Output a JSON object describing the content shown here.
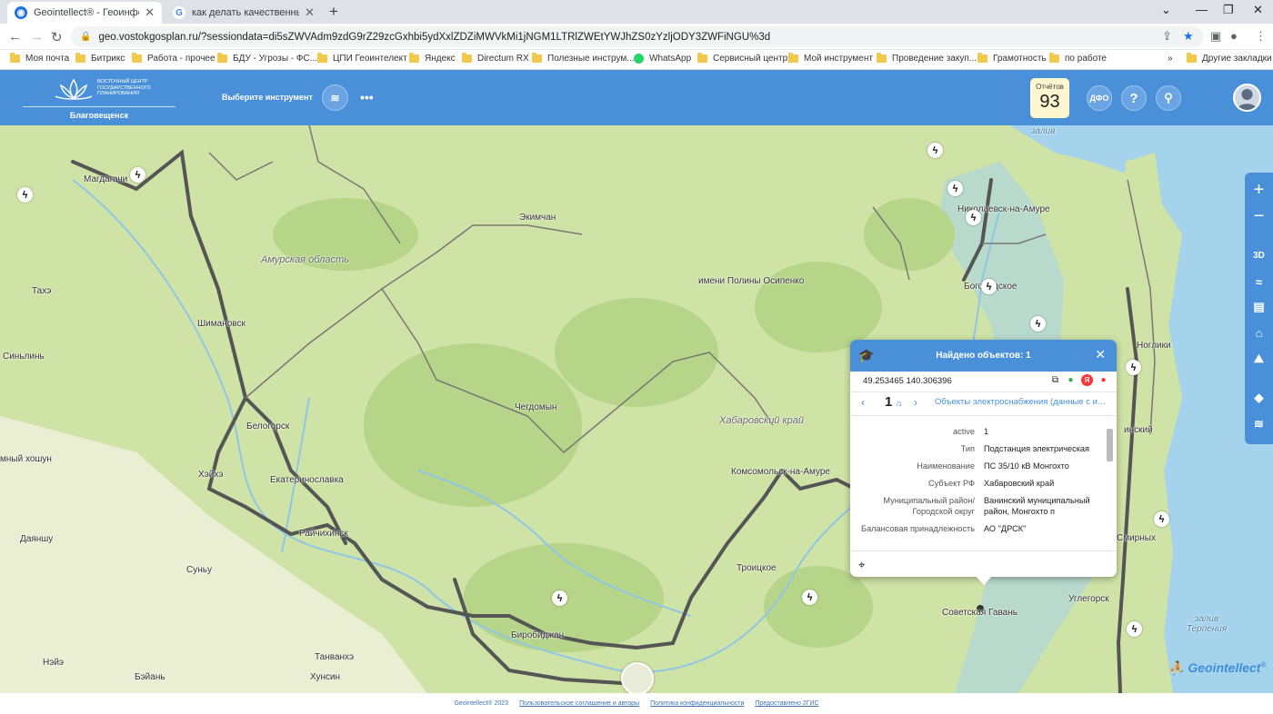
{
  "browser": {
    "tabs": [
      {
        "title": "Geointellect® - Геоинформаци",
        "active": true
      },
      {
        "title": "как делать качественные снимк",
        "active": false
      }
    ],
    "url": "geo.vostokgosplan.ru/?sessiondata=di5sZWVAdm9zdG9rZ29zcGxhbi5ydXxlZDZiMWVkMi1jNGM1LTRlZWEtYWJhZS0zYzljODY3ZWFiNGU%3d",
    "bookmarks": [
      "Моя почта",
      "Битрикс",
      "Работа - прочее",
      "БДУ - Угрозы - ФС...",
      "ЦПИ Геоинтелект",
      "Яндекс",
      "Directum RX",
      "Полезные инструм...",
      "WhatsApp",
      "Сервисный центр",
      "Мой инструмент",
      "Проведение закуп...",
      "Грамотность",
      "по работе"
    ],
    "other_bookmarks": "Другие закладки",
    "more_bookmarks": "»"
  },
  "header": {
    "org_name": "ВОСТОЧНЫЙ ЦЕНТР ГОСУДАРСТВЕННОГО ПЛАНИРОВАНИЯ",
    "city": "Благовещенск",
    "tool_select": "Выберите инструмент",
    "reports_label": "Отчётов",
    "reports_count": "93",
    "dfo": "ДФО",
    "help": "?"
  },
  "map_labels": {
    "zaliv_top": "залив",
    "magdagachi": "Магдагачи",
    "ekimchan": "Экимчан",
    "amur_region": "Амурская область",
    "takhe": "Тахэ",
    "sinlin": "Синьлинь",
    "shimanovsk": "Шимановск",
    "belogorsk": "Белогорск",
    "mny_khoshun": "мный хошун",
    "kheihe": "Хэйхэ",
    "ekaterinoslavka": "Екатеринославка",
    "raichikhinsk": "Райчихинск",
    "dayanshu": "Даяншу",
    "sunu": "Суньу",
    "tanvanhe": "Танванхэ",
    "neie": "Нэйэ",
    "beian": "Бэйань",
    "khunsin": "Хунсин",
    "birobidzhan": "Биробиджан",
    "chegdomyn": "Чегдомын",
    "polina_osipenko": "имени Полины Осипенко",
    "khabarovsk_krai": "Хабаровский край",
    "komsomolsk": "Комсомольск-на-Амуре",
    "troitskoe": "Троицкое",
    "nikolaevsk": "Николаевск-на-Амуре",
    "bogorodskoe": "Богородское",
    "nogliki": "Ноглики",
    "sakhalin_x": "инский",
    "smirnykh": "Смирных",
    "uglegorsk": "Углегорск",
    "sovetskaya_gavan": "Советская Гавань",
    "zaliv_terpeniya": "залив Терпения"
  },
  "popup": {
    "title": "Найдено объектов: 1",
    "coords": "49.253465 140.306396",
    "page": "1",
    "page_of": "/1",
    "layer": "Объекты электроснабжения (данные с инвестиционных программ)",
    "rows": [
      {
        "key": "active",
        "value": "1"
      },
      {
        "key": "Тип",
        "value": "Подстанция электрическая"
      },
      {
        "key": "Наименование",
        "value": "ПС 35/10 кВ Монгохто"
      },
      {
        "key": "Субъект РФ",
        "value": "Хабаровский край"
      },
      {
        "key": "Муниципальный район/ Городской округ",
        "value": "Ванинский муниципальный район, Монгохто п"
      },
      {
        "key": "Балансовая принадлежность",
        "value": "АО \"ДРСК\""
      }
    ]
  },
  "right_toolbar": {
    "zoom_in": "+",
    "zoom_out": "−",
    "three_d": "3D"
  },
  "brand": "Geointellect",
  "footer": {
    "copyright": "Geointellect® 2023",
    "agreement": "Пользовательское соглашение и авторы",
    "privacy": "Политика конфиденциальности",
    "provided": "Предоставлено 2ГИС"
  },
  "colors": {
    "header_blue": "#4a90d9",
    "map_land": "#cfe3a6",
    "sea": "#a6d3ec",
    "reports_bg": "#fdf6cf"
  }
}
